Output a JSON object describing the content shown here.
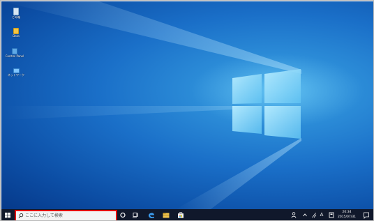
{
  "desktop": {
    "icons": [
      {
        "label": "ごみ箱"
      },
      {
        "label": "Data"
      },
      {
        "label": "Control Panel"
      },
      {
        "label": "ネットワーク"
      }
    ]
  },
  "taskbar": {
    "search_placeholder": "ここに入力して検索",
    "tray_a_label": "A",
    "clock_time": "20:34",
    "clock_date": "2015/07/31"
  },
  "colors": {
    "accent": "#e00000",
    "taskbar": "#10182b"
  }
}
